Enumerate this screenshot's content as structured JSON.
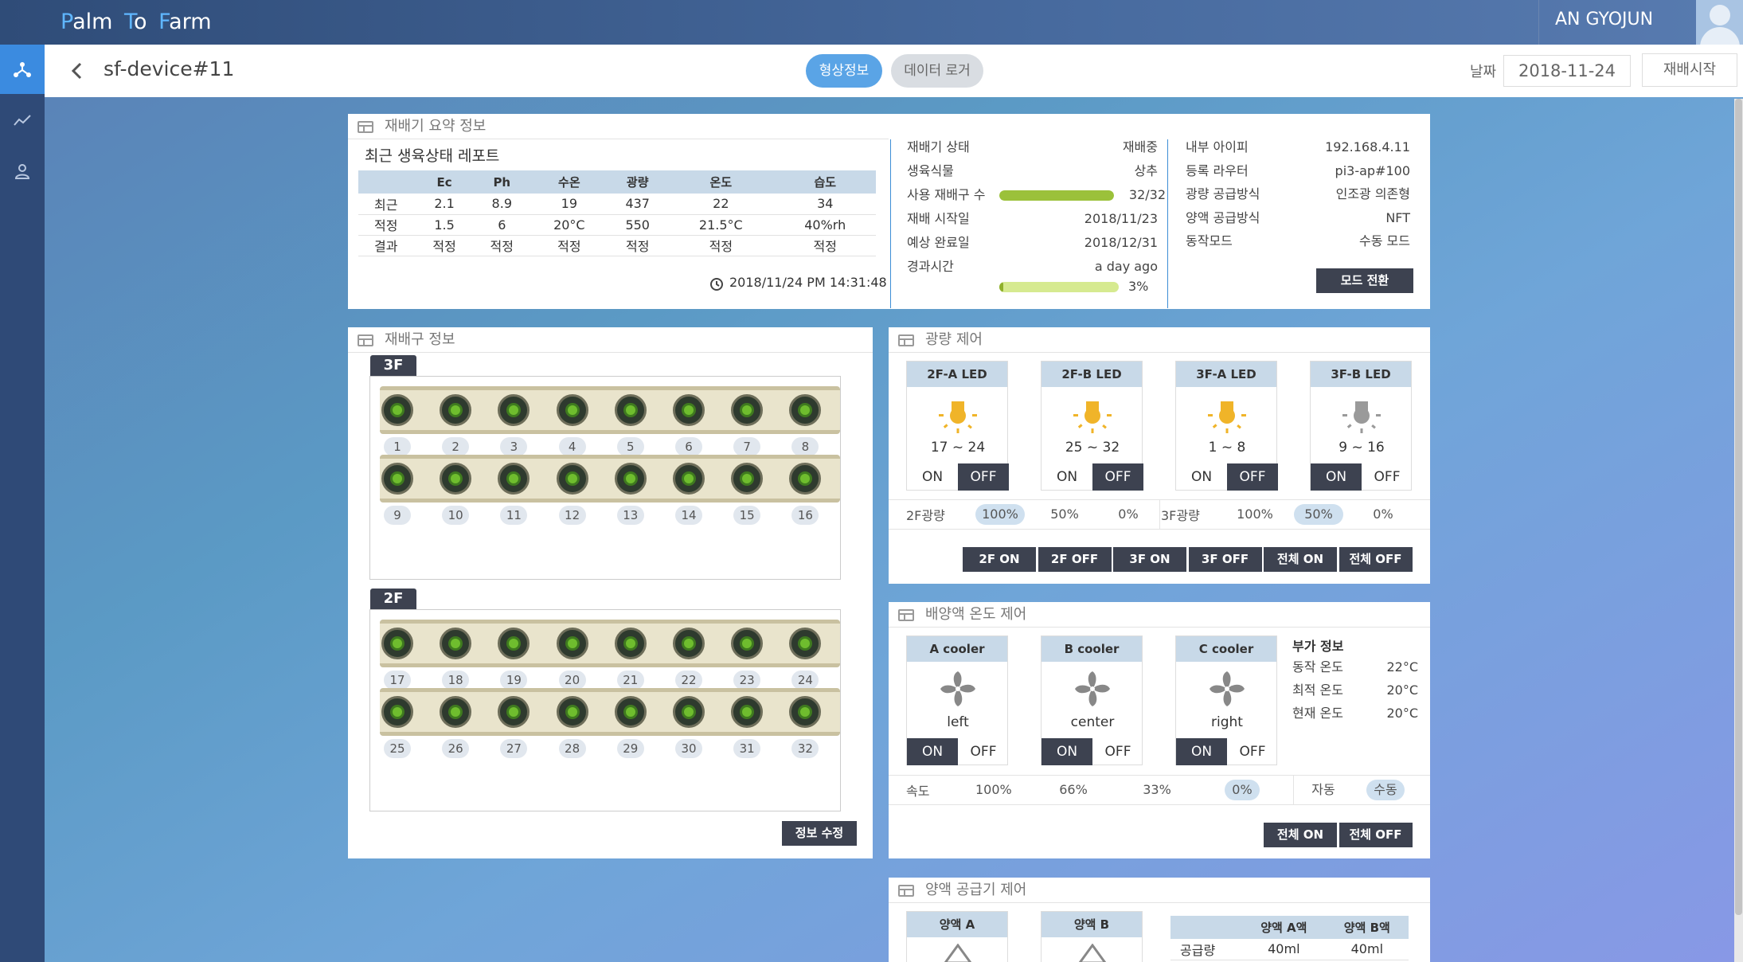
{
  "app": {
    "logo_parts": [
      [
        "P",
        "alm"
      ],
      [
        "T",
        "o"
      ],
      [
        "F",
        "arm"
      ]
    ],
    "user": "AN GYOJUN"
  },
  "sidebar": {
    "items": [
      {
        "icon": "network-icon",
        "active": true
      },
      {
        "icon": "chart-line-icon"
      },
      {
        "icon": "user-icon"
      }
    ]
  },
  "header": {
    "device": "sf-device#11",
    "tabs": [
      "형상정보",
      "데이터 로거"
    ],
    "date_label": "날짜",
    "date_value": "2018-11-24",
    "start_button": "재배시작"
  },
  "summary": {
    "title": "재배기 요약 정보",
    "report_title": "최근 생육상태 레포트",
    "columns": [
      "",
      "Ec",
      "Ph",
      "수온",
      "광량",
      "온도",
      "습도"
    ],
    "rows": [
      [
        "최근",
        "2.1",
        "8.9",
        "19",
        "437",
        "22",
        "34"
      ],
      [
        "적정",
        "1.5",
        "6",
        "20°C",
        "550",
        "21.5°C",
        "40%rh"
      ],
      [
        "결과",
        "적정",
        "적정",
        "적정",
        "적정",
        "적정",
        "적정"
      ]
    ],
    "timestamp": "2018/11/24 PM 14:31:48",
    "status": [
      {
        "label": "재배기 상태",
        "value": "재배중"
      },
      {
        "label": "생육식물",
        "value": "상추"
      },
      {
        "label": "사용 재배구 수",
        "value": "32/32",
        "progress": 1.0
      },
      {
        "label": "재배 시작일",
        "value": "2018/11/23"
      },
      {
        "label": "예상 완료일",
        "value": "2018/12/31"
      },
      {
        "label": "경과시간",
        "value": "a day ago"
      }
    ],
    "elapsed_percent": "3%",
    "elapsed_progress": 0.03,
    "info": [
      {
        "label": "내부 아이피",
        "value": "192.168.4.11"
      },
      {
        "label": "등록 라우터",
        "value": "pi3-ap#100"
      },
      {
        "label": "광량 공급방식",
        "value": "인조광 의존형"
      },
      {
        "label": "양액 공급방식",
        "value": "NFT"
      },
      {
        "label": "동작모드",
        "value": "수동 모드"
      }
    ],
    "mode_button": "모드 전환"
  },
  "slots": {
    "title": "재배구 정보",
    "floors": [
      {
        "name": "3F",
        "numbers": [
          "1",
          "2",
          "3",
          "4",
          "5",
          "6",
          "7",
          "8",
          "9",
          "10",
          "11",
          "12",
          "13",
          "14",
          "15",
          "16"
        ]
      },
      {
        "name": "2F",
        "numbers": [
          "17",
          "18",
          "19",
          "20",
          "21",
          "22",
          "23",
          "24",
          "25",
          "26",
          "27",
          "28",
          "29",
          "30",
          "31",
          "32"
        ]
      }
    ],
    "edit_button": "정보 수정"
  },
  "light": {
    "title": "광량 제어",
    "leds": [
      {
        "name": "2F-A LED",
        "range": "17 ~ 24",
        "state": "OFF",
        "color": "#f0b429"
      },
      {
        "name": "2F-B LED",
        "range": "25 ~ 32",
        "state": "OFF",
        "color": "#f0b429"
      },
      {
        "name": "3F-A LED",
        "range": "1 ~ 8",
        "state": "OFF",
        "color": "#f0b429"
      },
      {
        "name": "3F-B LED",
        "range": "9 ~ 16",
        "state": "ON",
        "color": "#9a9a9a"
      }
    ],
    "on_label": "ON",
    "off_label": "OFF",
    "levels": [
      {
        "label": "2F광량",
        "options": [
          "100%",
          "50%",
          "0%"
        ],
        "selected": 0
      },
      {
        "label": "3F광량",
        "options": [
          "100%",
          "50%",
          "0%"
        ],
        "selected": 1
      }
    ],
    "buttons": [
      "2F ON",
      "2F OFF",
      "3F ON",
      "3F OFF",
      "전체 ON",
      "전체 OFF"
    ]
  },
  "cooler": {
    "title": "배양액 온도 제어",
    "units": [
      {
        "name": "A cooler",
        "pos": "left",
        "state": "ON"
      },
      {
        "name": "B cooler",
        "pos": "center",
        "state": "ON"
      },
      {
        "name": "C cooler",
        "pos": "right",
        "state": "ON"
      }
    ],
    "extra_title": "부가 정보",
    "extra": [
      {
        "label": "동작 온도",
        "value": "22°C"
      },
      {
        "label": "최적 온도",
        "value": "20°C"
      },
      {
        "label": "현재 온도",
        "value": "20°C"
      }
    ],
    "speed_label": "속도",
    "speeds": [
      "100%",
      "66%",
      "33%",
      "0%"
    ],
    "speed_selected": 3,
    "mode_options": [
      "자동",
      "수동"
    ],
    "mode_selected": 1,
    "buttons": [
      "전체 ON",
      "전체 OFF"
    ]
  },
  "nutrient": {
    "title": "양액 공급기 제어",
    "pumps": [
      "양액 A",
      "양액 B"
    ],
    "columns": [
      "",
      "양액 A액",
      "양액 B액"
    ],
    "rows": [
      [
        "공급량",
        "40ml",
        "40ml"
      ]
    ]
  },
  "colors": {
    "accent": "#5aa4e6",
    "dark": "#3d4250",
    "table_head": "#c8d9e8",
    "progress_green": "#9bc13a",
    "progress_light": "#d6ea90"
  }
}
